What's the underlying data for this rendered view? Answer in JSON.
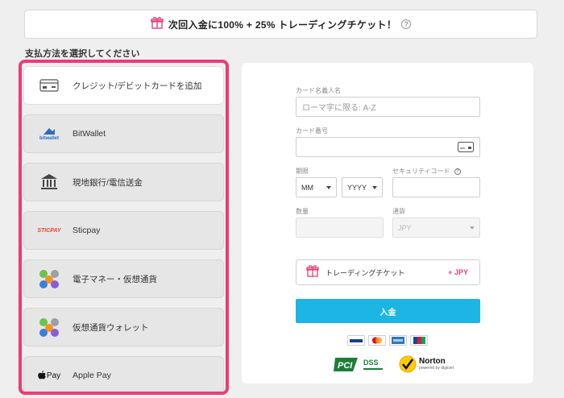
{
  "banner": {
    "text": "次回入金に100% + 25% トレーディングチケット！",
    "help": "?"
  },
  "section_title": "支払方法を選択してください",
  "methods": [
    {
      "label": "クレジット/デビットカードを追加",
      "icon": "credit-card-icon"
    },
    {
      "label": "BitWallet",
      "icon": "bitwallet-logo",
      "logo_text": "bitwallet"
    },
    {
      "label": "現地銀行/電信送金",
      "icon": "bank-icon"
    },
    {
      "label": "Sticpay",
      "icon": "sticpay-logo",
      "logo_text": "STICPAY"
    },
    {
      "label": "電子マネー・仮想通貨",
      "icon": "crypto-coins-icon"
    },
    {
      "label": "仮想通貨ウォレット",
      "icon": "crypto-coins-icon"
    },
    {
      "label": "Apple Pay",
      "icon": "apple-pay-logo",
      "logo_text": "Pay"
    }
  ],
  "form": {
    "cardholder_label": "カード名義人名",
    "cardholder_placeholder": "ローマ字に限る: A-Z",
    "card_number_label": "カード番号",
    "expiry_label": "期限",
    "month_value": "MM",
    "year_value": "YYYY",
    "cvv_label": "セキュリティコード",
    "quantity_label": "数量",
    "currency_label": "通貨",
    "currency_value": "JPY"
  },
  "ticket": {
    "label": "トレーディングチケット",
    "amount": "+ JPY"
  },
  "deposit_button": "入金",
  "badges": {
    "pci": "DSS",
    "norton": "Norton",
    "norton_sub": "powered by digicert"
  },
  "colors": {
    "accent_pink": "#ec3b77",
    "button_blue": "#1db5e3"
  }
}
